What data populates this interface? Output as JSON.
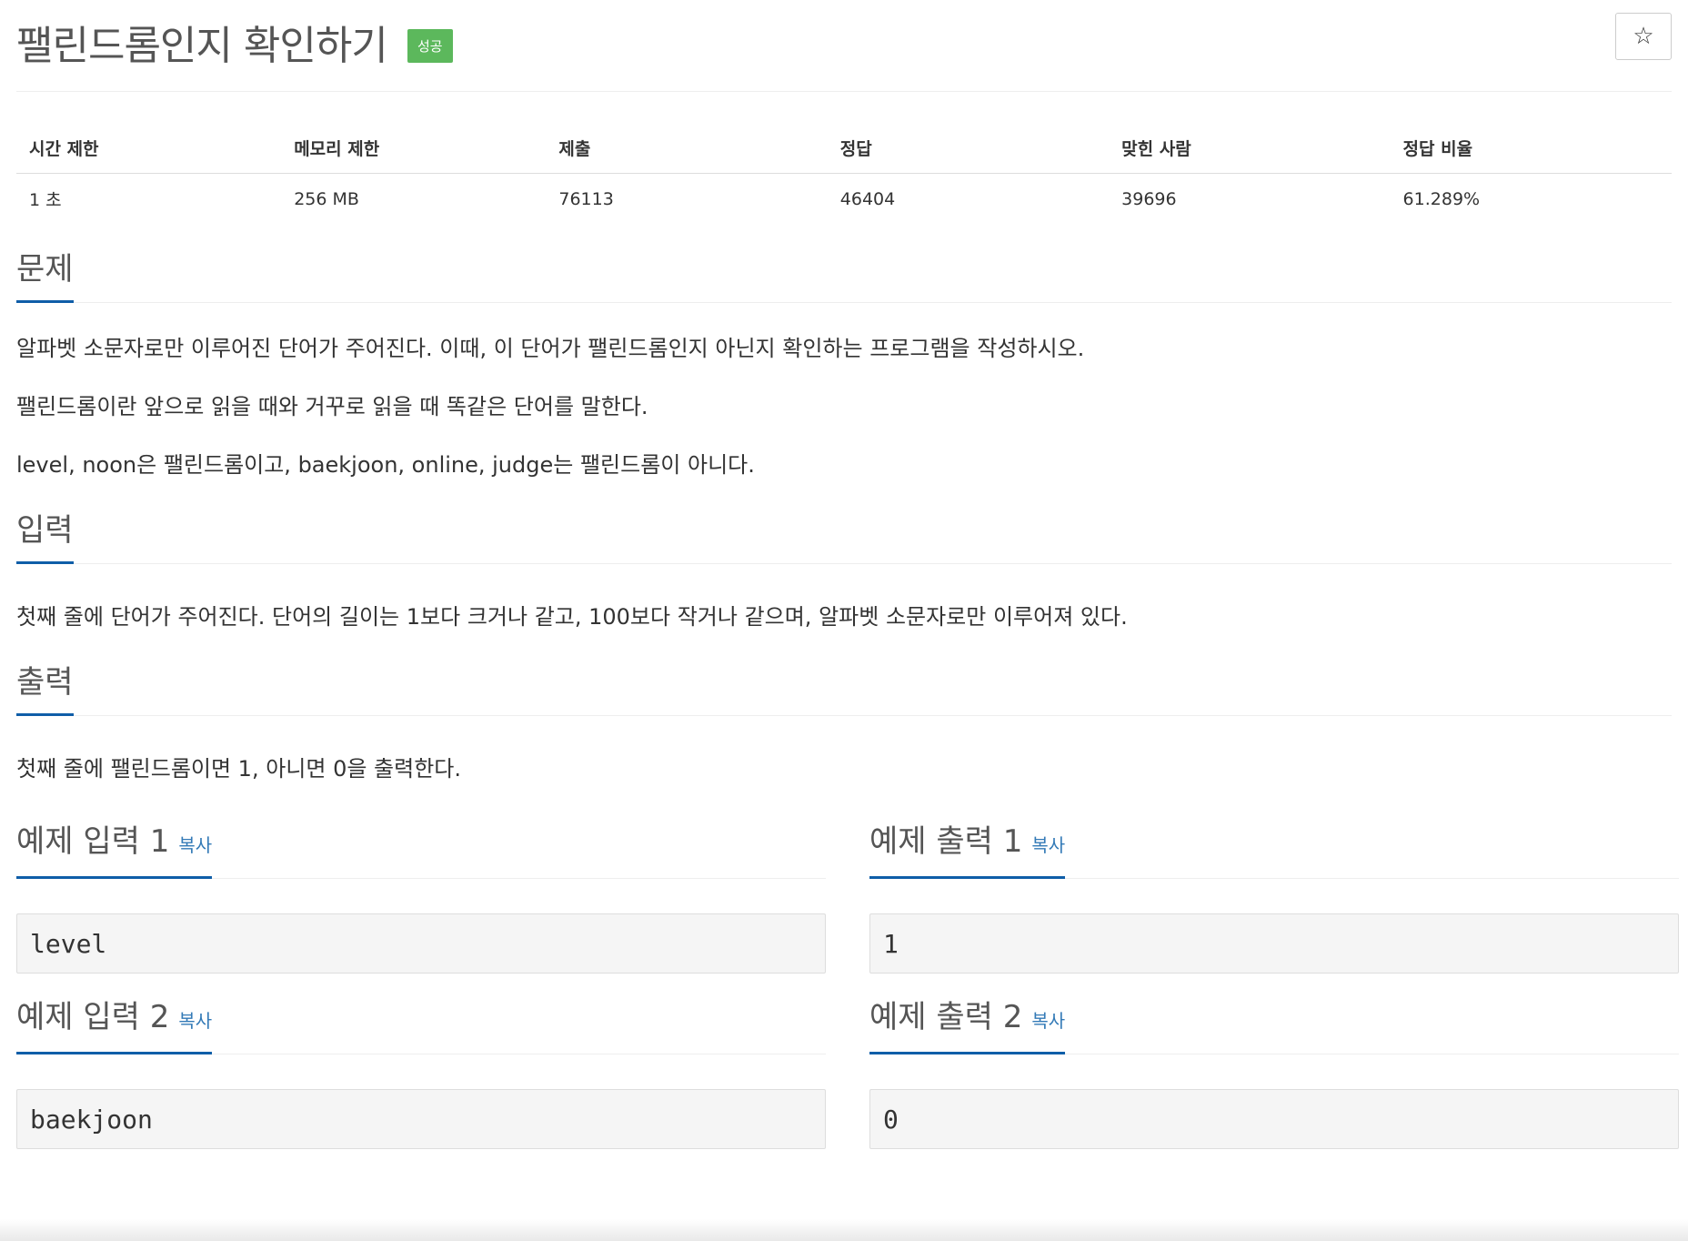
{
  "problem": {
    "title": "팰린드롬인지 확인하기",
    "status_badge": "성공",
    "bookmark_icon": "☆"
  },
  "stats": {
    "headers": [
      "시간 제한",
      "메모리 제한",
      "제출",
      "정답",
      "맞힌 사람",
      "정답 비율"
    ],
    "values": [
      "1 초",
      "256 MB",
      "76113",
      "46404",
      "39696",
      "61.289%"
    ]
  },
  "sections": {
    "problem": {
      "heading": "문제",
      "paragraphs": [
        "알파벳 소문자로만 이루어진 단어가 주어진다. 이때, 이 단어가 팰린드롬인지 아닌지 확인하는 프로그램을 작성하시오.",
        "팰린드롬이란 앞으로 읽을 때와 거꾸로 읽을 때 똑같은 단어를 말한다.",
        "level, noon은 팰린드롬이고, baekjoon, online, judge는 팰린드롬이 아니다."
      ]
    },
    "input": {
      "heading": "입력",
      "text": "첫째 줄에 단어가 주어진다. 단어의 길이는 1보다 크거나 같고, 100보다 작거나 같으며, 알파벳 소문자로만 이루어져 있다."
    },
    "output": {
      "heading": "출력",
      "text": "첫째 줄에 팰린드롬이면 1, 아니면 0을 출력한다."
    }
  },
  "samples": {
    "copy_label": "복사",
    "input1": {
      "heading": "예제 입력 1",
      "data": "level"
    },
    "output1": {
      "heading": "예제 출력 1",
      "data": "1"
    },
    "input2": {
      "heading": "예제 입력 2",
      "data": "baekjoon"
    },
    "output2": {
      "heading": "예제 출력 2",
      "data": "0"
    }
  },
  "colors": {
    "accent": "#0f5ea8",
    "success": "#5cb85c",
    "link": "#337ab7"
  }
}
